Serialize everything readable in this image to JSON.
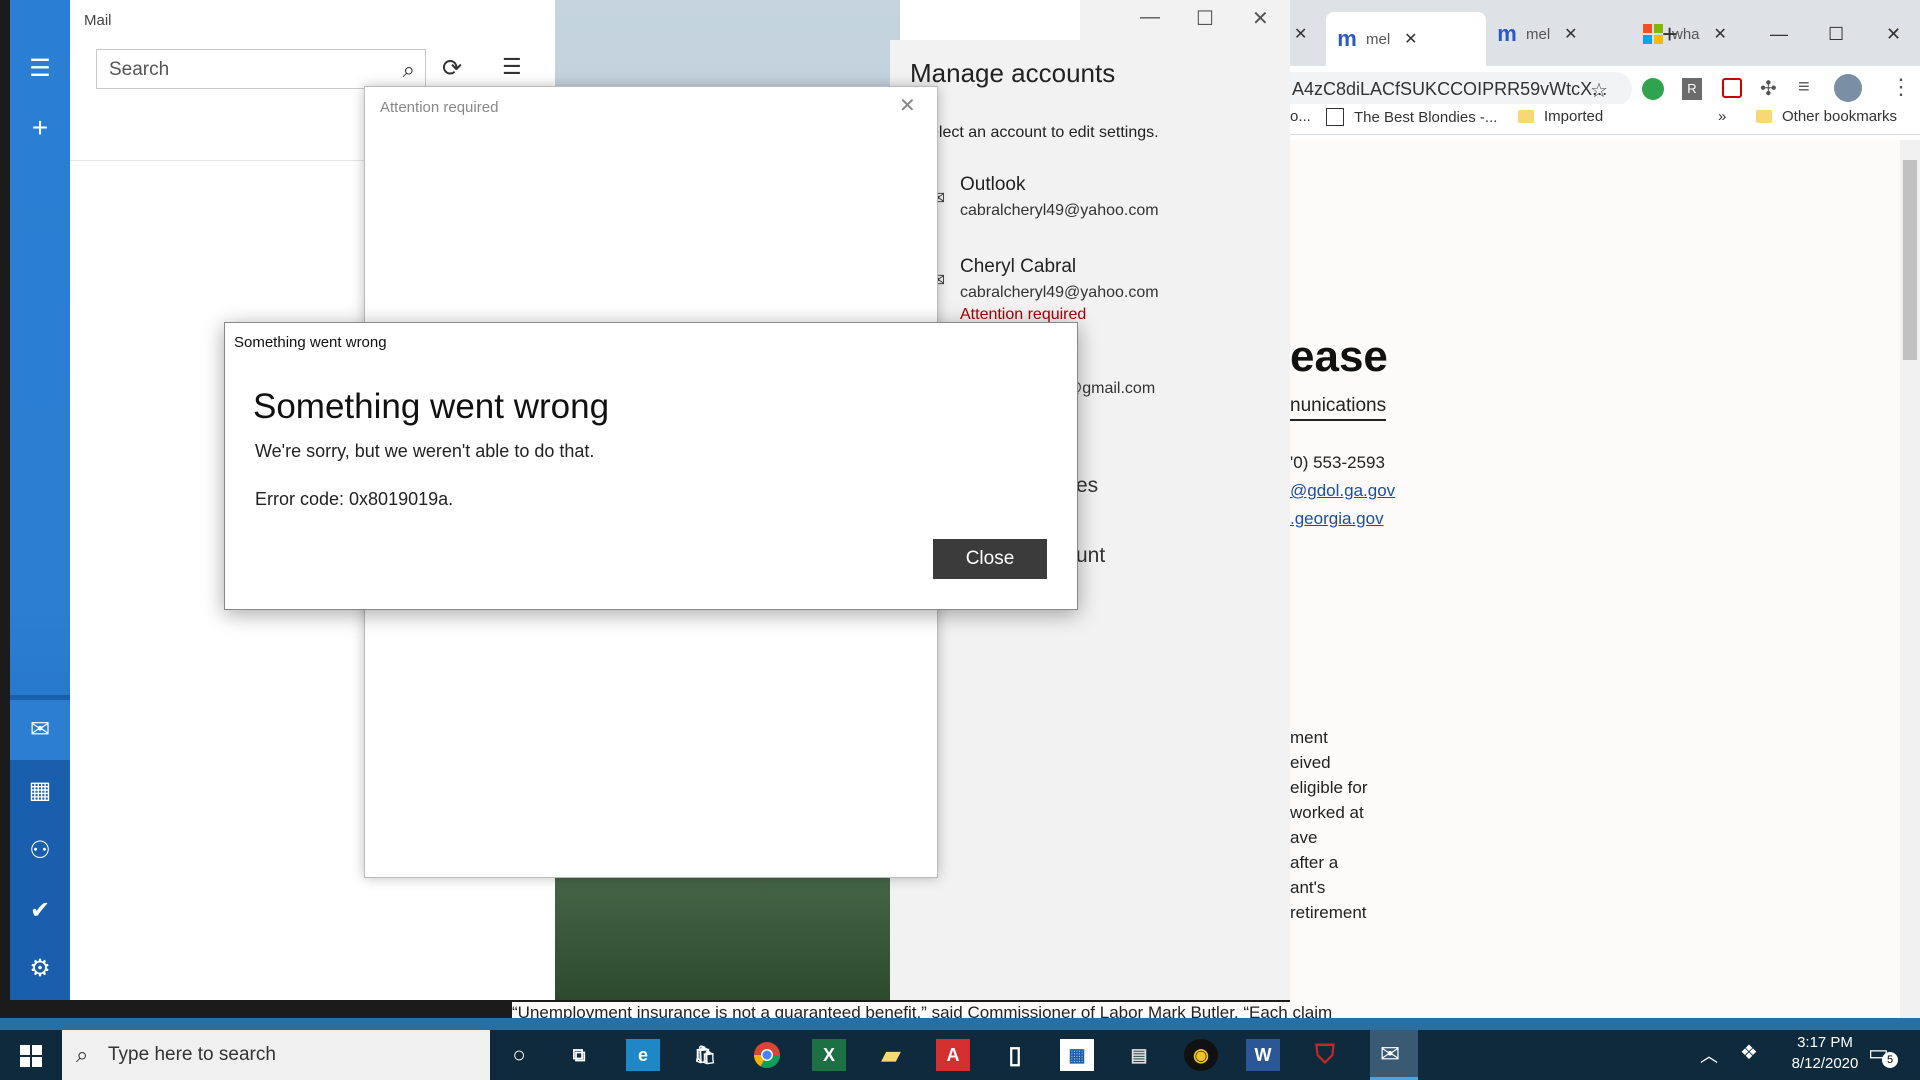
{
  "chrome": {
    "tabs": [
      {
        "icon": "m",
        "label": "mel"
      },
      {
        "icon": "m",
        "label": "mel"
      },
      {
        "icon": "microsoft-logo",
        "label": "wha"
      }
    ],
    "new_tab": "+",
    "url": "A4zC8diLACfSUKCCOIPRR59vWtcX...",
    "bookmarks": [
      "o...",
      "The Best Blondies -...",
      "Imported",
      "»",
      "Other bookmarks"
    ],
    "page": {
      "heading": "ease",
      "subheading": "nunications",
      "phone": "'0) 553-2593",
      "link1": "@gdol.ga.gov",
      "link2": ".georgia.gov",
      "body_lines": [
        "ment",
        "eived",
        "eligible for",
        "worked at",
        "ave",
        "after a",
        "ant's",
        "retirement"
      ],
      "bottom_quote": "“Unemployment insurance is not a guaranteed benefit,” said Commissioner of Labor Mark Butler. “Each claim"
    }
  },
  "mail": {
    "title": "Mail",
    "search_placeholder": "Search"
  },
  "manage": {
    "title": "Manage accounts",
    "instruction": "elect an account to edit settings.",
    "accounts": [
      {
        "name": "Outlook",
        "email": "cabralcheryl49@yahoo.com",
        "status": ""
      },
      {
        "name": "Cheryl Cabral",
        "email": "cabralcheryl49@yahoo.com",
        "status": "Attention required"
      }
    ],
    "partial_email": "@gmail.com",
    "partial_item1": "es",
    "partial_item2": "unt"
  },
  "attention": {
    "title": "Attention required"
  },
  "error": {
    "window_title": "Something went wrong",
    "heading": "Something went wrong",
    "message": "We're sorry, but we weren't able to do that.",
    "code": "Error code: 0x8019019a.",
    "close_label": "Close"
  },
  "taskbar": {
    "search_placeholder": "Type here to search",
    "time": "3:17 PM",
    "date": "8/12/2020",
    "notification_count": "5"
  }
}
